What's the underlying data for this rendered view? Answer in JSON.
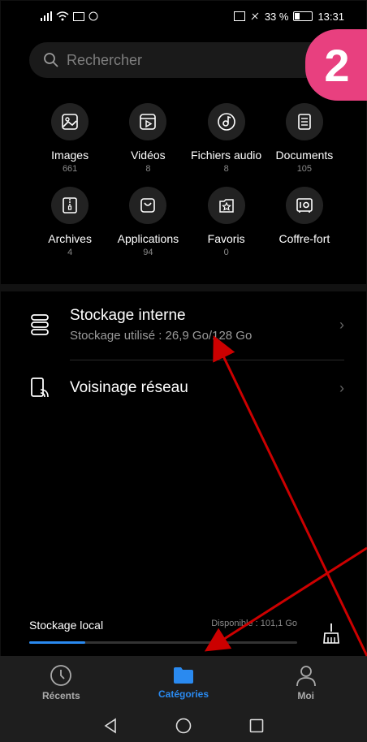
{
  "status": {
    "time": "13:31",
    "battery": "33 %"
  },
  "search": {
    "placeholder": "Rechercher"
  },
  "badge": {
    "number": "2"
  },
  "categories": [
    {
      "label": "Images",
      "count": "661",
      "icon": "image-icon"
    },
    {
      "label": "Vidéos",
      "count": "8",
      "icon": "video-icon"
    },
    {
      "label": "Fichiers audio",
      "count": "8",
      "icon": "music-icon"
    },
    {
      "label": "Documents",
      "count": "105",
      "icon": "document-icon"
    },
    {
      "label": "Archives",
      "count": "4",
      "icon": "archive-icon"
    },
    {
      "label": "Applications",
      "count": "94",
      "icon": "bag-icon"
    },
    {
      "label": "Favoris",
      "count": "0",
      "icon": "star-icon"
    },
    {
      "label": "Coffre-fort",
      "count": "",
      "icon": "safe-icon"
    }
  ],
  "internal": {
    "title": "Stockage interne",
    "subtitle": "Stockage utilisé : 26,9 Go/128 Go"
  },
  "network": {
    "title": "Voisinage réseau"
  },
  "local": {
    "title": "Stockage local",
    "available": "Disponible : 101,1 Go",
    "used_fraction": 0.21
  },
  "tabs": [
    {
      "label": "Récents",
      "icon": "clock-icon"
    },
    {
      "label": "Catégories",
      "icon": "folder-icon"
    },
    {
      "label": "Moi",
      "icon": "person-icon"
    }
  ],
  "colors": {
    "accent": "#2a8af0",
    "badge": "#e8407f",
    "arrow": "#cc0000"
  }
}
